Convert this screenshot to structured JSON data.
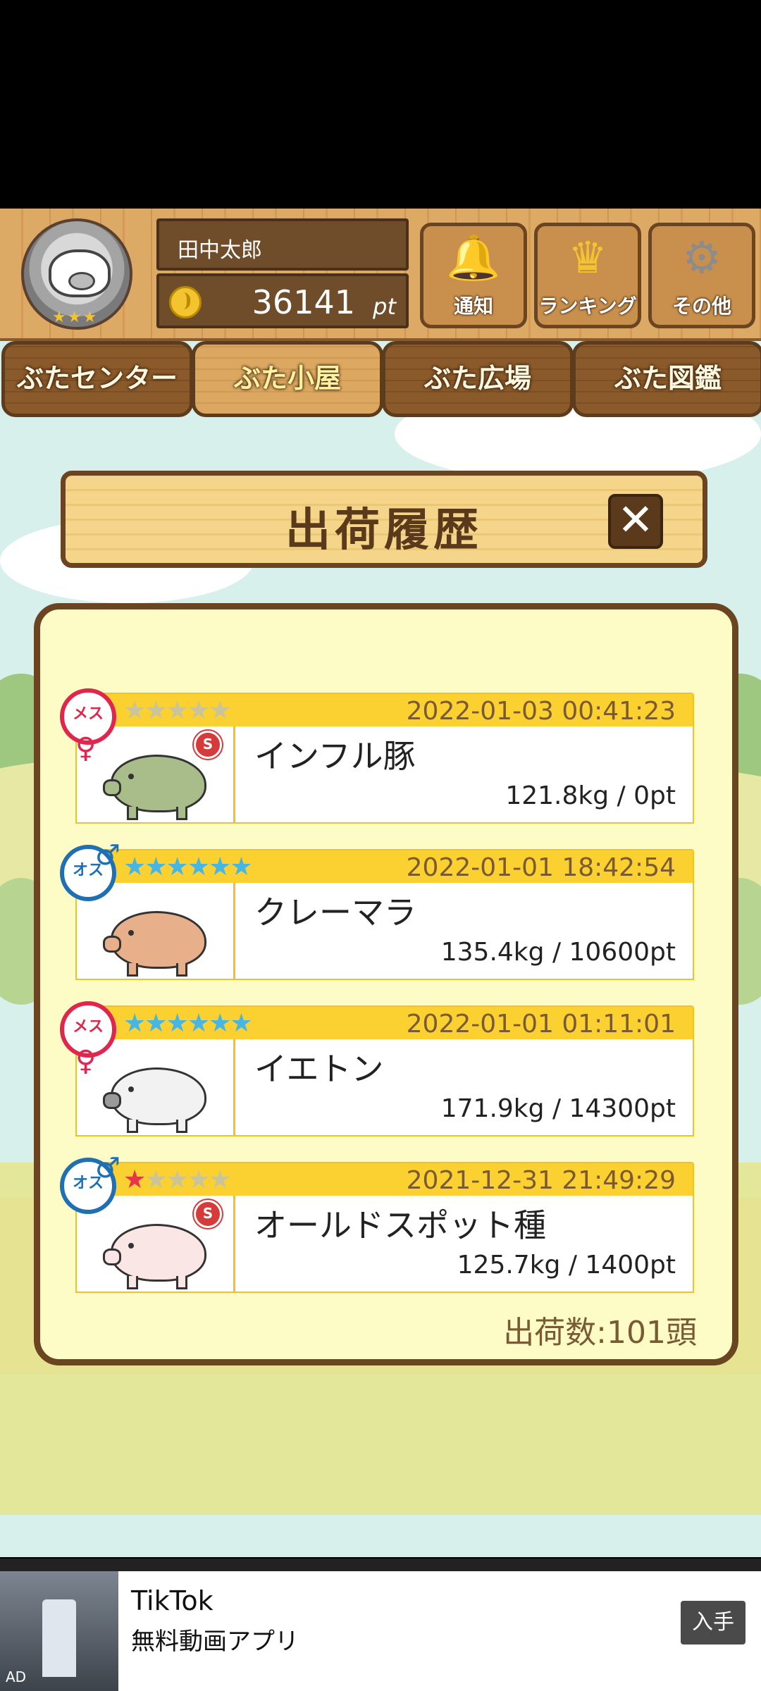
{
  "header": {
    "user_name": "田中太郎",
    "points_value": "36141",
    "points_unit": "pt",
    "avatar_stars": "★★★",
    "buttons": [
      {
        "label": "通知",
        "icon": "bell-icon"
      },
      {
        "label": "ランキング",
        "icon": "crown-icon"
      },
      {
        "label": "その他",
        "icon": "gear-icon"
      }
    ]
  },
  "tabs": [
    {
      "label": "ぶたセンター",
      "active": false
    },
    {
      "label": "ぶた小屋",
      "active": true
    },
    {
      "label": "ぶた広場",
      "active": false
    },
    {
      "label": "ぶた図鑑",
      "active": false
    }
  ],
  "dialog": {
    "title": "出荷履歴",
    "close_label": "✕",
    "entries": [
      {
        "gender": "メス",
        "gender_symbol": "♀",
        "stars_filled": 0,
        "stars_total": 5,
        "star_color": "gray",
        "date": "2022-01-03 00:41:23",
        "name": "インフル豚",
        "weight_points": "121.8kg / 0pt",
        "medal": "S",
        "pig_color": "#a9bd8a"
      },
      {
        "gender": "オス",
        "gender_symbol": "♂",
        "stars_filled": 6,
        "stars_total": 6,
        "star_color": "blue",
        "date": "2022-01-01 18:42:54",
        "name": "クレーマラ",
        "weight_points": "135.4kg / 10600pt",
        "medal": "",
        "pig_color": "#e8b08a"
      },
      {
        "gender": "メス",
        "gender_symbol": "♀",
        "stars_filled": 6,
        "stars_total": 6,
        "star_color": "blue",
        "date": "2022-01-01 01:11:01",
        "name": "イエトン",
        "weight_points": "171.9kg / 14300pt",
        "medal": "",
        "pig_color": "#f2f2f2"
      },
      {
        "gender": "オス",
        "gender_symbol": "♂",
        "stars_filled": 1,
        "stars_total": 5,
        "star_color": "red",
        "date": "2021-12-31 21:49:29",
        "name": "オールドスポット種",
        "weight_points": "125.7kg / 1400pt",
        "medal": "S",
        "pig_color": "#fbe6e6"
      }
    ],
    "count_label": "出荷数:101頭"
  },
  "ad": {
    "title": "TikTok",
    "subtitle": "無料動画アプリ",
    "button_label": "入手",
    "tag": "AD"
  }
}
